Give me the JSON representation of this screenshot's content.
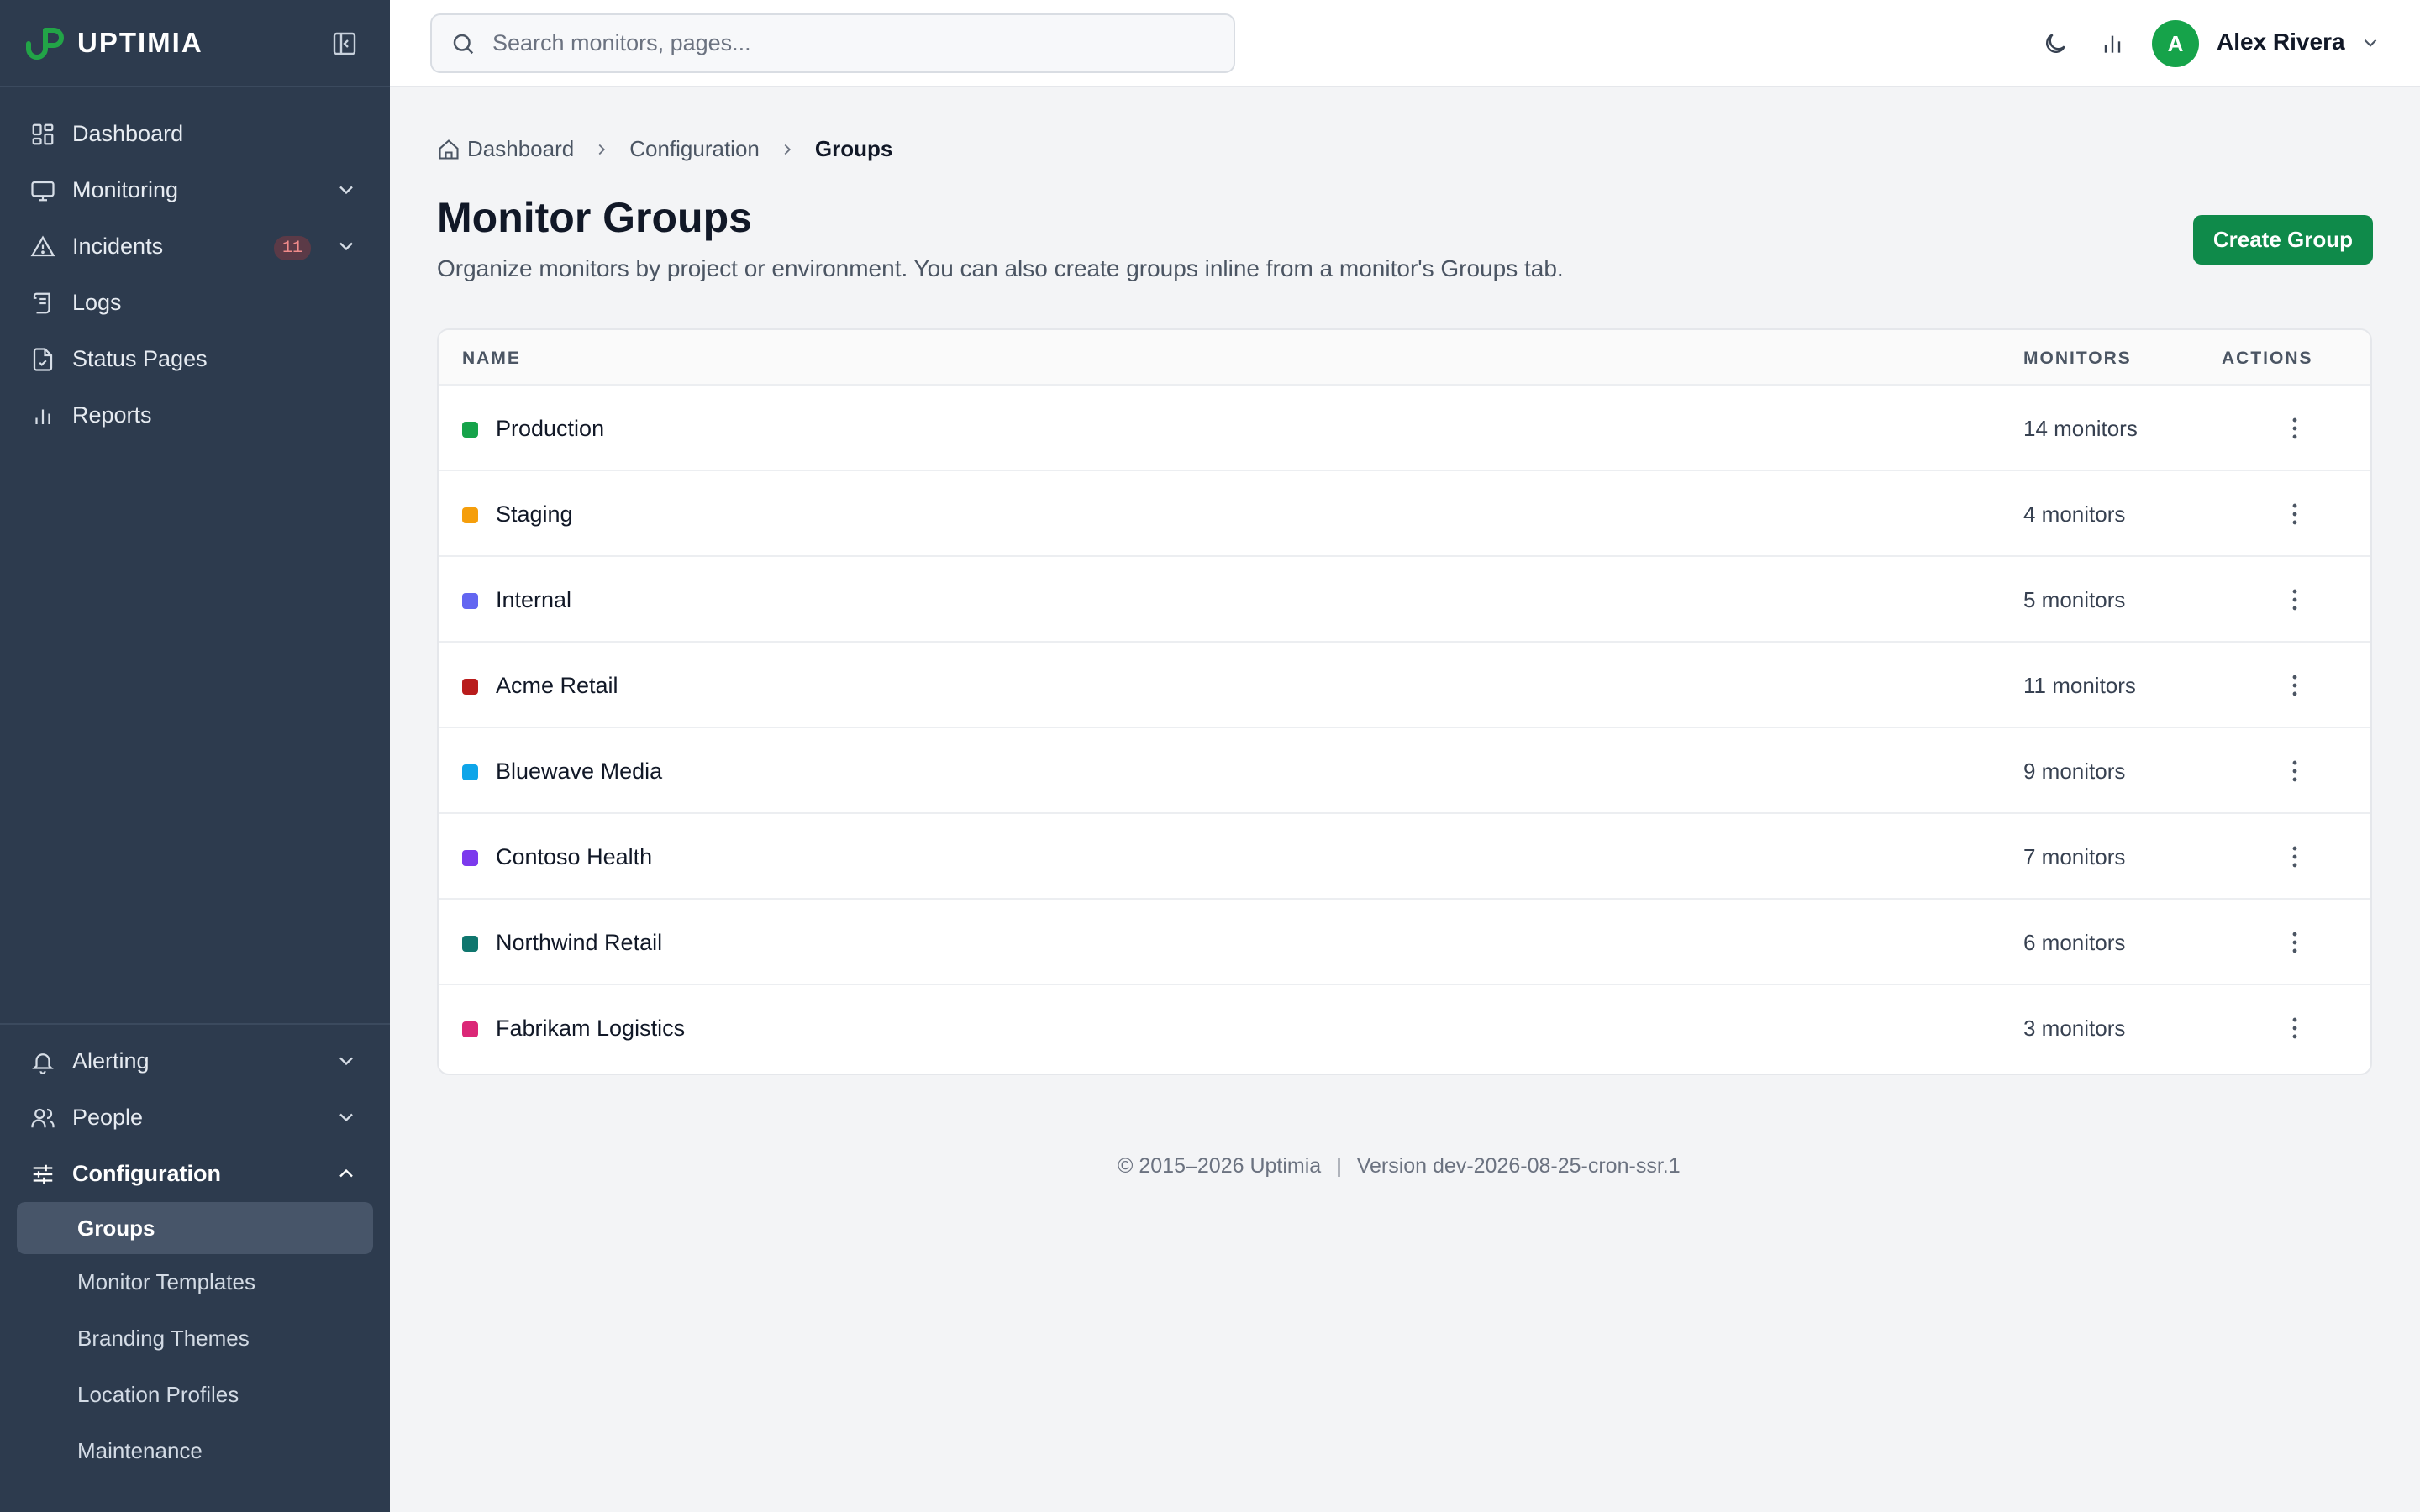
{
  "app": {
    "name": "UPTIMIA"
  },
  "sidebar": {
    "top_items": [
      {
        "label": "Dashboard",
        "icon": "dashboard-icon"
      },
      {
        "label": "Monitoring",
        "icon": "monitor-icon"
      },
      {
        "label": "Incidents",
        "icon": "warning-icon",
        "badge": "11"
      },
      {
        "label": "Logs",
        "icon": "scroll-icon"
      },
      {
        "label": "Status Pages",
        "icon": "file-check-icon"
      },
      {
        "label": "Reports",
        "icon": "bar-chart-icon"
      }
    ],
    "bottom_items": [
      {
        "label": "Alerting",
        "icon": "bell-icon"
      },
      {
        "label": "People",
        "icon": "users-icon"
      },
      {
        "label": "Configuration",
        "icon": "sliders-icon"
      }
    ],
    "config_subitems": [
      "Groups",
      "Monitor Templates",
      "Branding Themes",
      "Location Profiles",
      "Maintenance"
    ]
  },
  "topbar": {
    "search_placeholder": "Search monitors, pages...",
    "user": {
      "initial": "A",
      "name": "Alex Rivera"
    }
  },
  "breadcrumb": [
    "Dashboard",
    "Configuration",
    "Groups"
  ],
  "page": {
    "title": "Monitor Groups",
    "description": "Organize monitors by project or environment. You can also create groups inline from a monitor's Groups tab.",
    "create_button": "Create Group"
  },
  "table": {
    "headers": {
      "name": "NAME",
      "monitors": "MONITORS",
      "actions": "ACTIONS"
    },
    "rows": [
      {
        "name": "Production",
        "monitors": "14 monitors",
        "color": "#16a34a"
      },
      {
        "name": "Staging",
        "monitors": "4 monitors",
        "color": "#f59e0b"
      },
      {
        "name": "Internal",
        "monitors": "5 monitors",
        "color": "#6366f1"
      },
      {
        "name": "Acme Retail",
        "monitors": "11 monitors",
        "color": "#b91c1c"
      },
      {
        "name": "Bluewave Media",
        "monitors": "9 monitors",
        "color": "#0ea5e9"
      },
      {
        "name": "Contoso Health",
        "monitors": "7 monitors",
        "color": "#7c3aed"
      },
      {
        "name": "Northwind Retail",
        "monitors": "6 monitors",
        "color": "#0f766e"
      },
      {
        "name": "Fabrikam Logistics",
        "monitors": "3 monitors",
        "color": "#db2777"
      }
    ]
  },
  "footer": {
    "copyright": "© 2015–2026 Uptimia",
    "separator": "|",
    "version": "Version dev-2026-08-25-cron-ssr.1"
  }
}
